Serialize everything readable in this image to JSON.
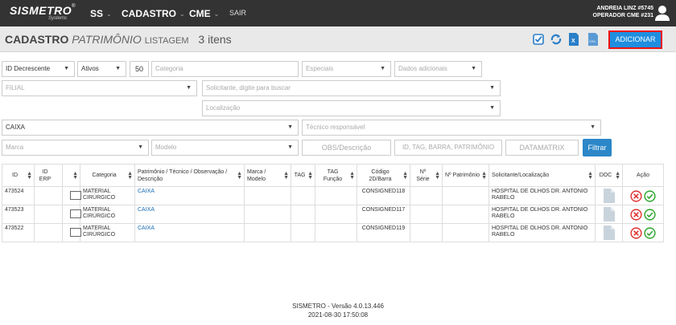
{
  "nav": {
    "logo": "SISMETRO",
    "logo_reg": "®",
    "logo_sub": "Systems",
    "items": [
      {
        "label": "SS"
      },
      {
        "label": "CADASTRO"
      },
      {
        "label": "CME"
      }
    ],
    "sair": "SAIR",
    "user_line1": "ANDREIA LINZ #5745",
    "user_line2": "OPERADOR CME #231"
  },
  "title": {
    "part1": "CADASTRO",
    "part2": "PATRIMÔNIO",
    "part3": "LISTAGEM",
    "count": "3 itens",
    "add_button": "ADICIONAR"
  },
  "filters": {
    "order": "ID Decrescente",
    "status": "Ativos",
    "page_size": "50",
    "categoria": "Categoria",
    "especiais": "Especiais",
    "dados_adicionais": "Dados adicionais",
    "filial": "FILIAL",
    "solicitante": "Solicitante, digite para buscar",
    "localizacao": "Localização",
    "caixa": "CAIXA",
    "tecnico": "Técnico responsável",
    "marca": "Marca",
    "modelo": "Modelo",
    "obs": "OBS/Descrição",
    "id_tag": "ID, TAG, BARRA, PATRIMÔNIO",
    "datamatrix": "DATAMATRIX",
    "filtrar": "Filtrar"
  },
  "table": {
    "headers": [
      "ID",
      "ID ERP",
      "",
      "Categoria",
      "Patrimônio / Técnico / Observação / Descrição",
      "Marca / Modelo",
      "TAG",
      "TAG Função",
      "Código 2D/Barra",
      "Nº Série",
      "Nº Patrimônio",
      "Solicitante/Localização",
      "DOC",
      "Ação"
    ],
    "rows": [
      {
        "id": "473524",
        "categoria": "MATERIAL CIRÚRGICO",
        "patrimonio": "CAIXA",
        "codigo": "CONSIGNED118",
        "solicitante": "HOSPITAL DE OLHOS DR. ANTONIO RABELO"
      },
      {
        "id": "473523",
        "categoria": "MATERIAL CIRÚRGICO",
        "patrimonio": "CAIXA",
        "codigo": "CONSIGNED117",
        "solicitante": "HOSPITAL DE OLHOS DR. ANTONIO RABELO"
      },
      {
        "id": "473522",
        "categoria": "MATERIAL CIRÚRGICO",
        "patrimonio": "CAIXA",
        "codigo": "CONSIGNED119",
        "solicitante": "HOSPITAL DE OLHOS DR. ANTONIO RABELO"
      }
    ]
  },
  "footer": {
    "version": "SISMETRO - Versão 4.0.13.446",
    "datetime": "2021-08-30 17:50:08"
  },
  "colors": {
    "navbar": "#333333",
    "accent": "#1f8ee0",
    "delete": "#e03030",
    "confirm": "#2aa52a"
  }
}
